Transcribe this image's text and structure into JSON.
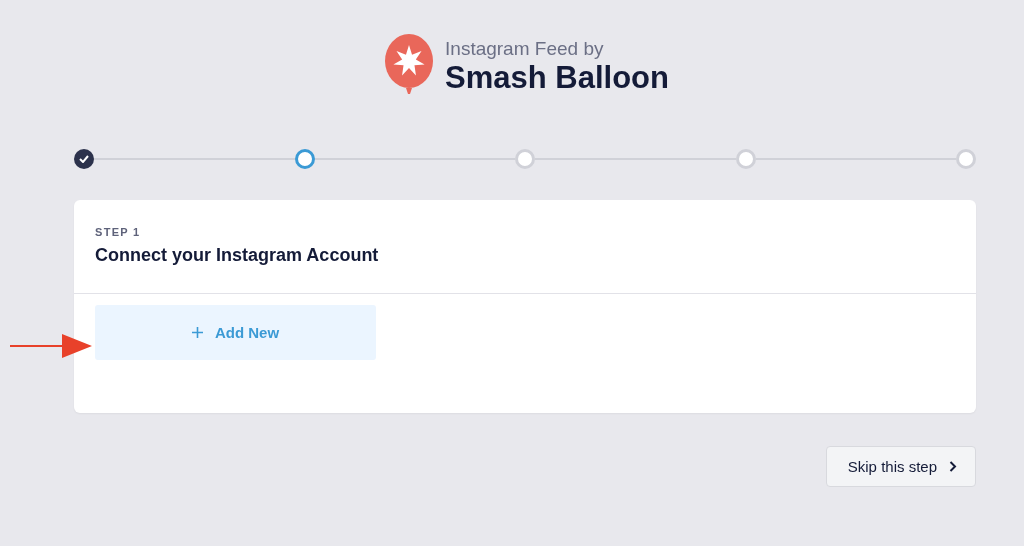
{
  "header": {
    "subtitle": "Instagram Feed by",
    "title": "Smash Balloon"
  },
  "steps": [
    {
      "completed": true,
      "selected": false
    },
    {
      "completed": false,
      "selected": true
    },
    {
      "completed": false,
      "selected": false
    },
    {
      "completed": false,
      "selected": false
    },
    {
      "completed": false,
      "selected": false
    }
  ],
  "card": {
    "eyebrow": "STEP 1",
    "heading": "Connect your Instagram Account",
    "add_button": "Add New"
  },
  "skip_button": "Skip this step"
}
